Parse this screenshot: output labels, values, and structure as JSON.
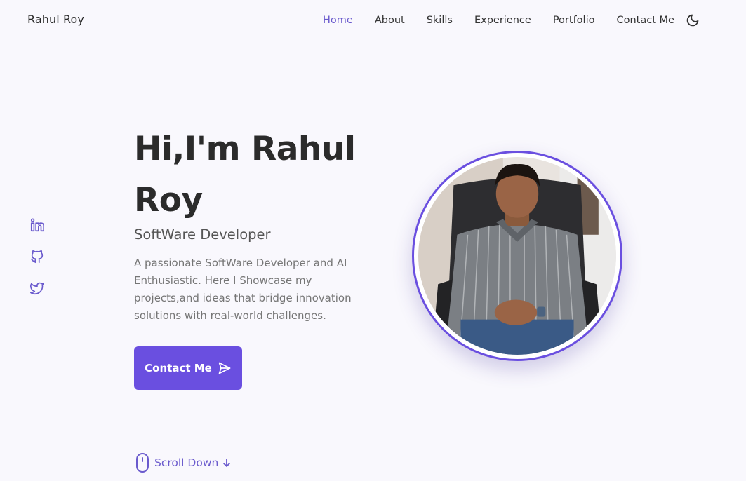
{
  "header": {
    "brand": "Rahul Roy",
    "nav": [
      "Home",
      "About",
      "Skills",
      "Experience",
      "Portfolio",
      "Contact Me"
    ],
    "active_nav": "Home",
    "theme_icon": "moon-icon"
  },
  "social": [
    "linkedin-icon",
    "github-icon",
    "twitter-icon"
  ],
  "hero": {
    "title": "Hi,I'm Rahul Roy",
    "subtitle": "SoftWare Developer",
    "description": "A passionate SoftWare Developer and AI Enthusiastic. Here I Showcase my projects,and ideas that bridge innovation solutions with real-world challenges.",
    "cta_label": "Contact Me",
    "cta_icon": "send-icon"
  },
  "scroll": {
    "label": "Scroll Down",
    "icon": "mouse-icon"
  },
  "colors": {
    "accent": "#6a4fe0",
    "background": "#f9f8fd"
  }
}
